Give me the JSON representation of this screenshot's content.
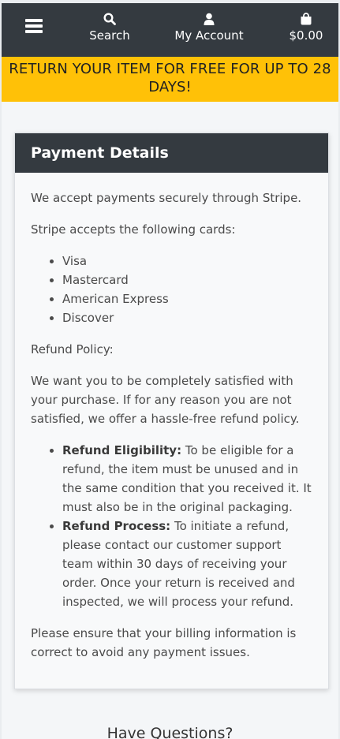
{
  "nav": {
    "search_label": "Search",
    "account_label": "My Account",
    "cart_label": "$0.00",
    "icons": [
      "menu-icon",
      "search-icon",
      "user-icon",
      "shopping-bag-icon"
    ]
  },
  "promo": {
    "text": "RETURN YOUR ITEM FOR FREE FOR UP TO 28 DAYS!"
  },
  "payment": {
    "title": "Payment Details",
    "intro": "We accept payments securely through Stripe.",
    "cards_intro": "Stripe accepts the following cards:",
    "cards": [
      "Visa",
      "Mastercard",
      "American Express",
      "Discover"
    ],
    "refund_heading": "Refund Policy:",
    "refund_intro": "We want you to be completely satisfied with your purchase. If for any reason you are not satisfied, we offer a hassle-free refund policy.",
    "policies": [
      {
        "label": "Refund Eligibility:",
        "text": " To be eligible for a refund, the item must be unused and in the same condition that you received it. It must also be in the original packaging."
      },
      {
        "label": "Refund Process:",
        "text": " To initiate a refund, please contact our customer support team within 30 days of receiving your order. Once your return is received and inspected, we will process your refund."
      }
    ],
    "closing": "Please ensure that your billing information is correct to avoid any payment issues."
  },
  "footer": {
    "questions_heading": "Have Questions?"
  },
  "colors": {
    "topbar": "#343a40",
    "promo": "#ffc107",
    "card_header": "#343a40"
  }
}
